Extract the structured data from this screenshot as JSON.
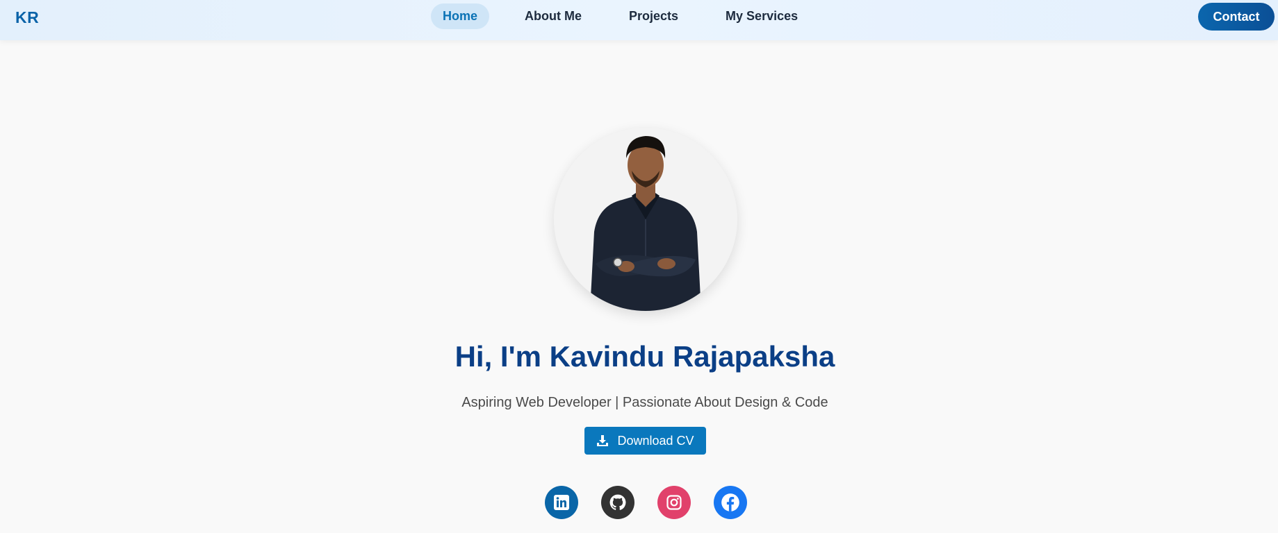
{
  "header": {
    "logo": "KR",
    "nav": [
      {
        "label": "Home",
        "active": true
      },
      {
        "label": "About Me",
        "active": false
      },
      {
        "label": "Projects",
        "active": false
      },
      {
        "label": "My Services",
        "active": false
      }
    ],
    "contact_label": "Contact"
  },
  "hero": {
    "title": "Hi, I'm Kavindu Rajapaksha",
    "subtitle": "Aspiring Web Developer | Passionate About Design & Code",
    "download_label": "Download CV",
    "download_icon": "download-icon"
  },
  "socials": [
    {
      "name": "linkedin-icon",
      "color": "#0a66a8"
    },
    {
      "name": "github-icon",
      "color": "#333333"
    },
    {
      "name": "instagram-icon",
      "color": "#e1416b"
    },
    {
      "name": "facebook-icon",
      "color": "#1877f2"
    }
  ],
  "colors": {
    "accent": "#0a78bd",
    "title": "#0b3f86",
    "nav_active_bg": "#cfe5f7"
  }
}
